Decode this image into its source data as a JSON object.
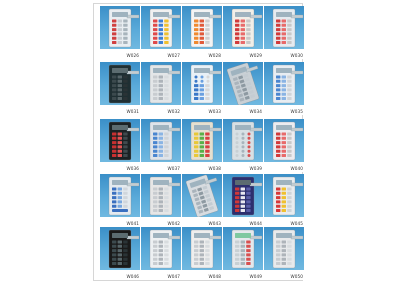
{
  "gallery": {
    "items": [
      {
        "code": "W026",
        "panel_color": "#e9eef2",
        "style": "light-buttons"
      },
      {
        "code": "W027",
        "panel_color": "#f1f1f1",
        "style": "light-color-keys"
      },
      {
        "code": "W028",
        "panel_color": "#f4f4f4",
        "style": "light-orange-keys"
      },
      {
        "code": "W029",
        "panel_color": "#f2efe8",
        "style": "light-red-keys"
      },
      {
        "code": "W030",
        "panel_color": "#e6ebf0",
        "style": "light-red-keys"
      },
      {
        "code": "W031",
        "panel_color": "#1f2f33",
        "style": "dark-display"
      },
      {
        "code": "W032",
        "panel_color": "#e3e6e8",
        "style": "light-grid"
      },
      {
        "code": "W033",
        "panel_color": "#e9f1f7",
        "style": "light-blue-dial"
      },
      {
        "code": "W034",
        "panel_color": "#c9d0d5",
        "style": "angled-grey"
      },
      {
        "code": "W035",
        "panel_color": "#e8edf2",
        "style": "light-blue-keys"
      },
      {
        "code": "W036",
        "panel_color": "#1b2224",
        "style": "dark-red-stripes"
      },
      {
        "code": "W037",
        "panel_color": "#dfe4ea",
        "style": "light-blue-keys"
      },
      {
        "code": "W038",
        "panel_color": "#e6e0d0",
        "style": "light-yellow-green"
      },
      {
        "code": "W039",
        "panel_color": "#d8e0e4",
        "style": "light-round"
      },
      {
        "code": "W040",
        "panel_color": "#ececf0",
        "style": "light-red-keys"
      },
      {
        "code": "W041",
        "panel_color": "#e4eaef",
        "style": "light-blue-oval"
      },
      {
        "code": "W042",
        "panel_color": "#e6e6e6",
        "style": "light-grid"
      },
      {
        "code": "W043",
        "panel_color": "#d8dce0",
        "style": "angled-grey"
      },
      {
        "code": "W044",
        "panel_color": "#2c2f6e",
        "style": "navy-red"
      },
      {
        "code": "W045",
        "panel_color": "#e9ecef",
        "style": "light-red-yellow"
      },
      {
        "code": "W046",
        "panel_color": "#1a1a1a",
        "style": "dark-display"
      },
      {
        "code": "W047",
        "panel_color": "#edf0f2",
        "style": "light-grid"
      },
      {
        "code": "W048",
        "panel_color": "#eeeeee",
        "style": "light-grid"
      },
      {
        "code": "W049",
        "panel_color": "#e4e8ec",
        "style": "green-display"
      },
      {
        "code": "W050",
        "panel_color": "#e8eaec",
        "style": "light-grid"
      }
    ]
  }
}
